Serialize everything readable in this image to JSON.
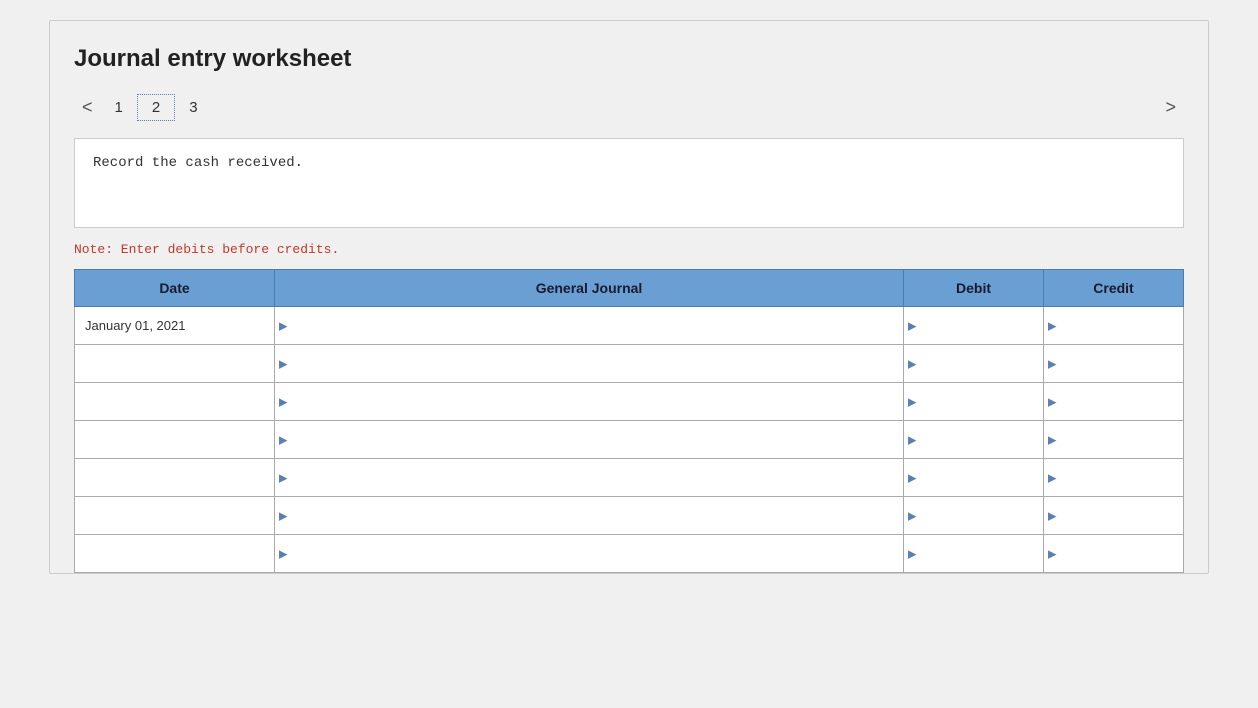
{
  "page": {
    "background": "#f0f0f0"
  },
  "worksheet": {
    "title": "Journal entry worksheet",
    "nav": {
      "left_arrow": "<",
      "right_arrow": ">",
      "pages": [
        {
          "label": "1",
          "active": false
        },
        {
          "label": "2",
          "active": true
        },
        {
          "label": "3",
          "active": false
        }
      ]
    },
    "instruction": "Record the cash received.",
    "note": "Note: Enter debits before credits.",
    "table": {
      "headers": {
        "date": "Date",
        "general_journal": "General Journal",
        "debit": "Debit",
        "credit": "Credit"
      },
      "rows": [
        {
          "date": "January 01, 2021",
          "journal": "",
          "debit": "",
          "credit": ""
        },
        {
          "date": "",
          "journal": "",
          "debit": "",
          "credit": ""
        },
        {
          "date": "",
          "journal": "",
          "debit": "",
          "credit": ""
        },
        {
          "date": "",
          "journal": "",
          "debit": "",
          "credit": ""
        },
        {
          "date": "",
          "journal": "",
          "debit": "",
          "credit": ""
        },
        {
          "date": "",
          "journal": "",
          "debit": "",
          "credit": ""
        },
        {
          "date": "",
          "journal": "",
          "debit": "",
          "credit": ""
        }
      ]
    }
  }
}
